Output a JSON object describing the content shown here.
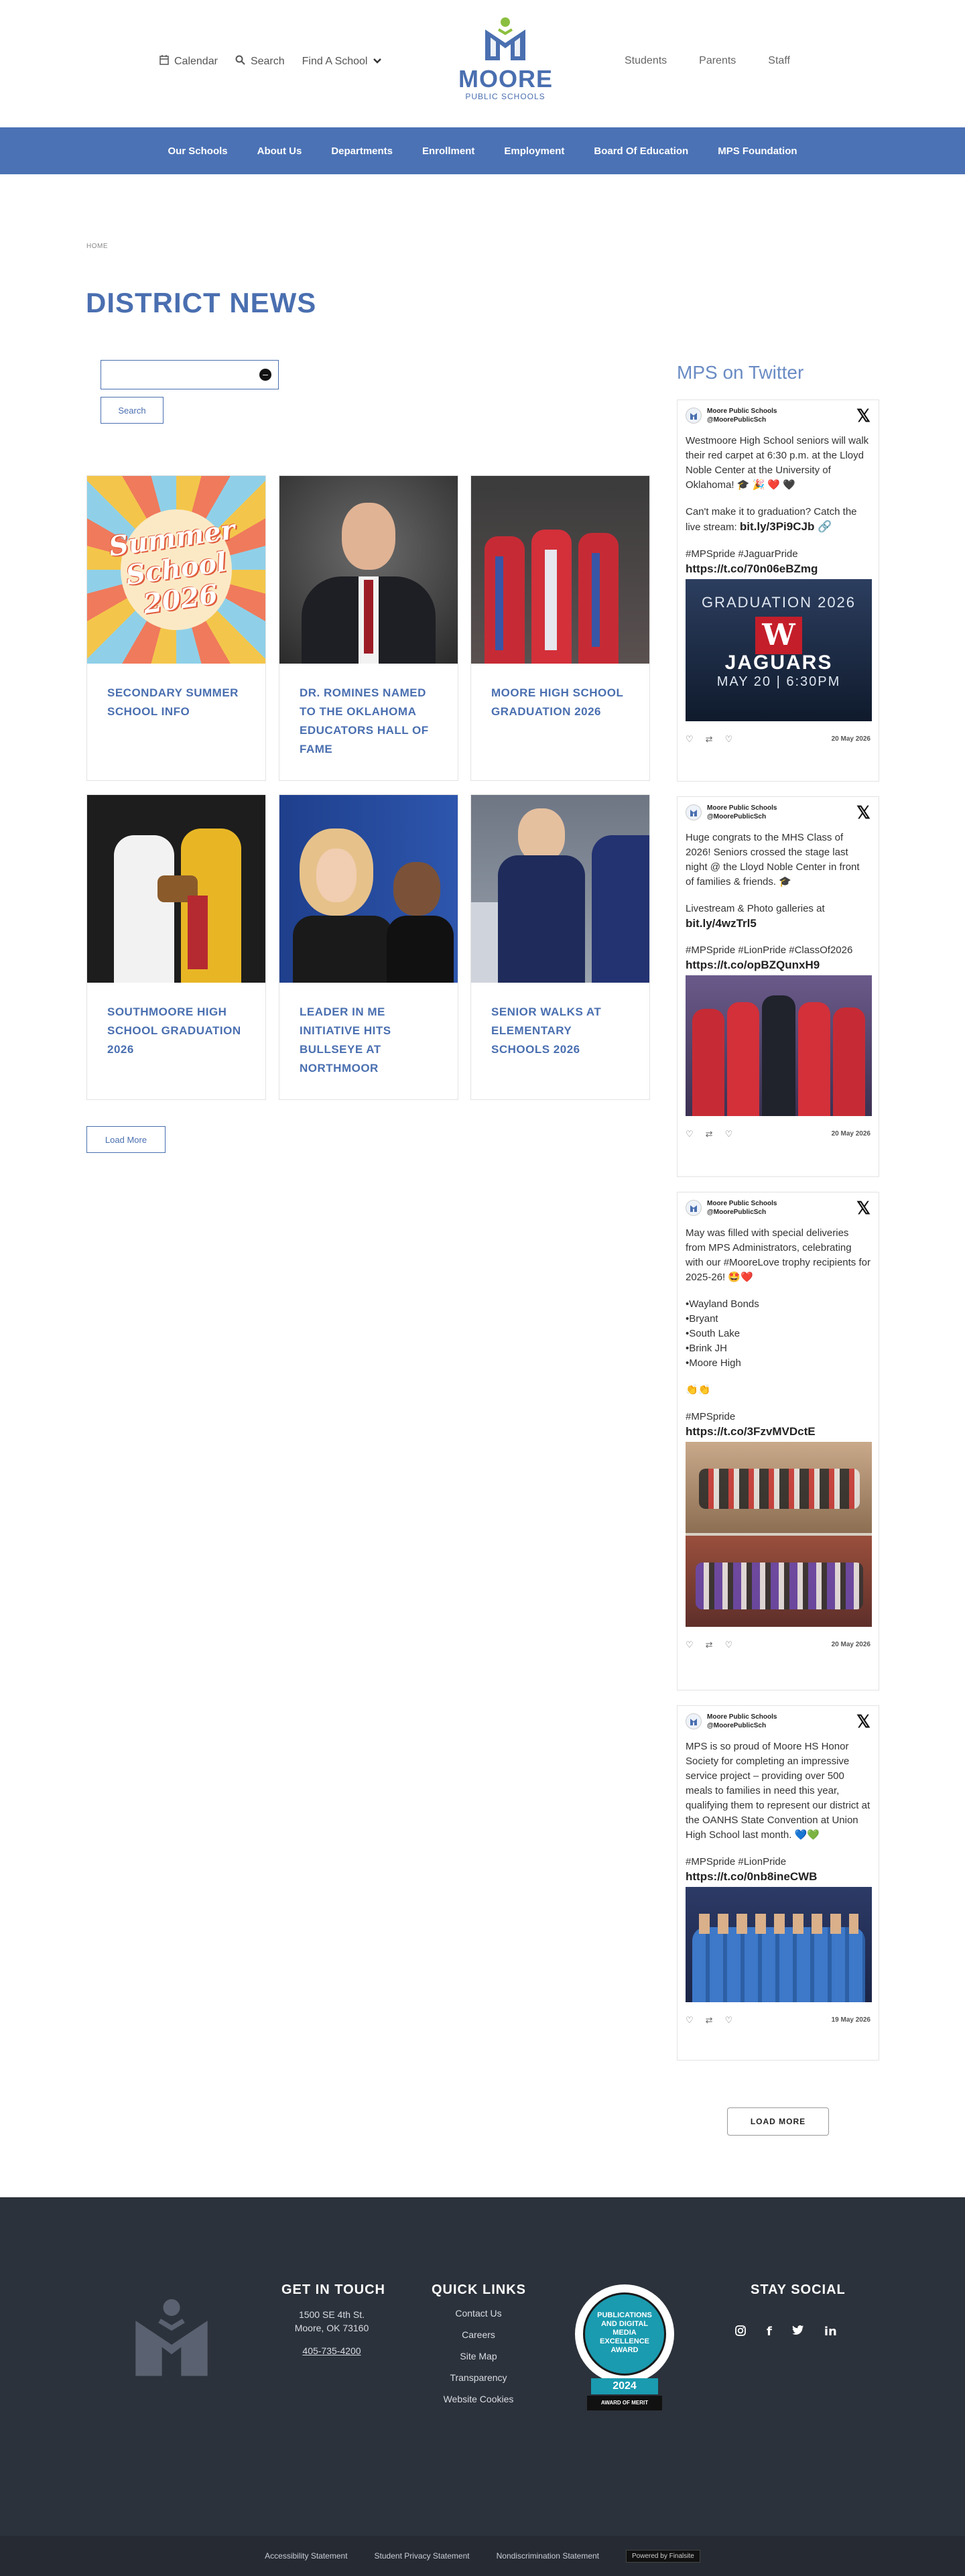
{
  "header": {
    "utility_left": [
      {
        "label": "Calendar",
        "icon": "calendar-icon"
      },
      {
        "label": "Search",
        "icon": "search-icon"
      },
      {
        "label": "Find A School",
        "icon": "chevron-down-icon"
      }
    ],
    "logo_word": "MOORE",
    "logo_sub": "PUBLIC SCHOOLS",
    "utility_right": [
      "Students",
      "Parents",
      "Staff"
    ]
  },
  "nav": [
    "Our Schools",
    "About Us",
    "Departments",
    "Enrollment",
    "Employment",
    "Board Of Education",
    "MPS Foundation"
  ],
  "breadcrumb": "HOME",
  "page_title": "DISTRICT NEWS",
  "search": {
    "button": "Search"
  },
  "news": [
    {
      "title": "SECONDARY SUMMER SCHOOL INFO",
      "image_text": "Summer School 2026"
    },
    {
      "title": "DR. ROMINES NAMED TO THE OKLAHOMA EDUCATORS HALL OF FAME"
    },
    {
      "title": "MOORE HIGH SCHOOL GRADUATION 2026"
    },
    {
      "title": "SOUTHMOORE HIGH SCHOOL GRADUATION 2026"
    },
    {
      "title": "LEADER IN ME INITIATIVE HITS BULLSEYE AT NORTHMOOR"
    },
    {
      "title": "SENIOR WALKS AT ELEMENTARY SCHOOLS 2026"
    }
  ],
  "load_more_news": "Load More",
  "twitter": {
    "title": "MPS on Twitter",
    "account_name": "Moore Public Schools",
    "account_handle": "@MoorePublicSch",
    "tweets": [
      {
        "paras": [
          "Westmoore High School seniors will walk their red carpet at 6:30 p.m. at the Lloyd Noble Center at the University of Oklahoma! 🎓 🎉 ❤️ 🖤",
          "Can't make it to graduation? Catch the live stream:"
        ],
        "inline_link": "bit.ly/3Pi9CJb 🔗",
        "hashtags": "#MPSpride #JaguarPride",
        "link": "https://t.co/70n06eBZmg",
        "image_text_1": "GRADUATION 2026",
        "image_text_2": "JAGUARS",
        "image_text_3": "MAY 20 | 6:30PM",
        "date": "20 May 2026"
      },
      {
        "paras": [
          "Huge congrats to the MHS Class of 2026! Seniors crossed the stage last night @ the Lloyd Noble Center in front of families & friends. 🎓",
          "Livestream & Photo galleries at"
        ],
        "inline_link": "bit.ly/4wzTrl5",
        "hashtags": "#MPSpride #LionPride #ClassOf2026",
        "link": "https://t.co/opBZQunxH9",
        "date": "20 May 2026"
      },
      {
        "paras": [
          "May was filled with special deliveries from MPS Administrators, celebrating with our #MooreLove trophy recipients for 2025-26! 🤩❤️"
        ],
        "list": [
          "•Wayland Bonds",
          "•Bryant",
          "•South Lake",
          "•Brink JH",
          "•Moore High"
        ],
        "emoji": "👏👏",
        "hashtags": "#MPSpride",
        "link": "https://t.co/3FzvMVDctE",
        "date": "20 May 2026"
      },
      {
        "paras": [
          "MPS is so proud of Moore HS Honor Society for completing an impressive service project – providing over 500 meals to families in need this year, qualifying them to represent our district at the OANHS State Convention at Union High School last month. 💙💚"
        ],
        "hashtags": "#MPSpride #LionPride",
        "link": "https://t.co/0nb8ineCWB",
        "date": "19 May 2026"
      }
    ],
    "load_more": "LOAD MORE"
  },
  "footer": {
    "get_in_touch_title": "GET IN TOUCH",
    "address_1": "1500 SE 4th St.",
    "address_2": "Moore, OK  73160",
    "phone": "405-735-4200",
    "quick_links_title": "QUICK LINKS",
    "quick_links": [
      "Contact Us",
      "Careers",
      "Site Map",
      "Transparency",
      "Website Cookies"
    ],
    "award_text": "PUBLICATIONS AND DIGITAL MEDIA EXCELLENCE AWARD",
    "award_year": "2024",
    "award_merit": "AWARD OF MERIT",
    "stay_social_title": "STAY SOCIAL",
    "bottom_links": [
      "Accessibility Statement",
      "Student Privacy Statement",
      "Nondiscrimination Statement"
    ],
    "powered_by": "Powered by Finalsite"
  },
  "colors": {
    "brand_blue": "#4b72b5",
    "footer_bg": "#2c323b",
    "accent_green": "#8bbf3f"
  }
}
